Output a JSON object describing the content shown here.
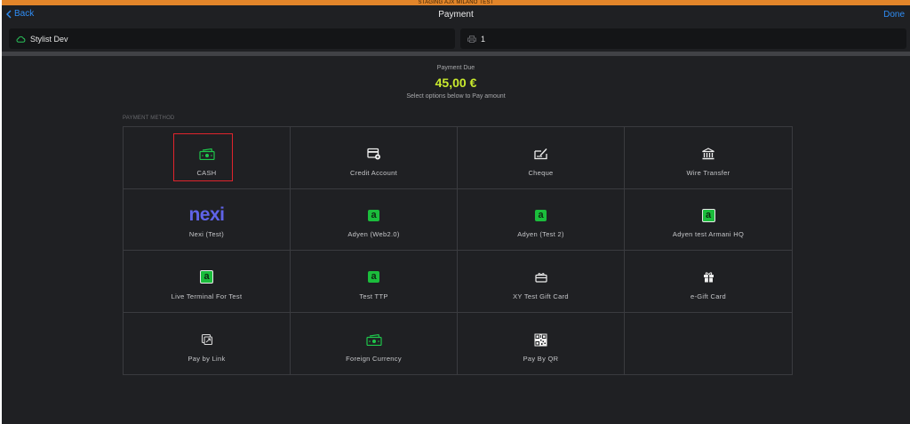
{
  "banner": {
    "text": "STAGING AJX MILANO TEST"
  },
  "nav": {
    "back_label": "Back",
    "title": "Payment",
    "done_label": "Done"
  },
  "fields": {
    "stylist_value": "Stylist Dev",
    "register_value": "1"
  },
  "payment": {
    "due_label": "Payment Due",
    "amount": "45,00 €",
    "subtitle": "Select options below to Pay amount",
    "section_label": "PAYMENT METHOD"
  },
  "colors": {
    "accent": "#2f8df5",
    "amount": "#c9ea2e",
    "brand_green": "#1bbd3c",
    "nexi": "#5f63e8",
    "banner": "#e2852a",
    "selection": "#e0242c"
  },
  "methods": [
    {
      "label": "CASH",
      "icon": "cash-icon",
      "selected": true
    },
    {
      "label": "Credit Account",
      "icon": "credit-account-icon"
    },
    {
      "label": "Cheque",
      "icon": "cheque-icon"
    },
    {
      "label": "Wire Transfer",
      "icon": "bank-icon"
    },
    {
      "label": "Nexi (Test)",
      "icon": "nexi-logo",
      "logo_text": "nexi"
    },
    {
      "label": "Adyen (Web2.0)",
      "icon": "adyen-icon",
      "logo_text": "a"
    },
    {
      "label": "Adyen (Test 2)",
      "icon": "adyen-icon",
      "logo_text": "a"
    },
    {
      "label": "Adyen test Armani HQ",
      "icon": "adyen-terminal-icon",
      "logo_text": "a"
    },
    {
      "label": "Live Terminal For Test",
      "icon": "adyen-terminal-icon",
      "logo_text": "a"
    },
    {
      "label": "Test TTP",
      "icon": "adyen-icon",
      "logo_text": "a"
    },
    {
      "label": "XY Test Gift Card",
      "icon": "gift-card-icon"
    },
    {
      "label": "e-Gift Card",
      "icon": "gift-icon"
    },
    {
      "label": "Pay by Link",
      "icon": "pay-by-link-icon"
    },
    {
      "label": "Foreign Currency",
      "icon": "foreign-currency-icon"
    },
    {
      "label": "Pay By QR",
      "icon": "qr-code-icon"
    }
  ]
}
